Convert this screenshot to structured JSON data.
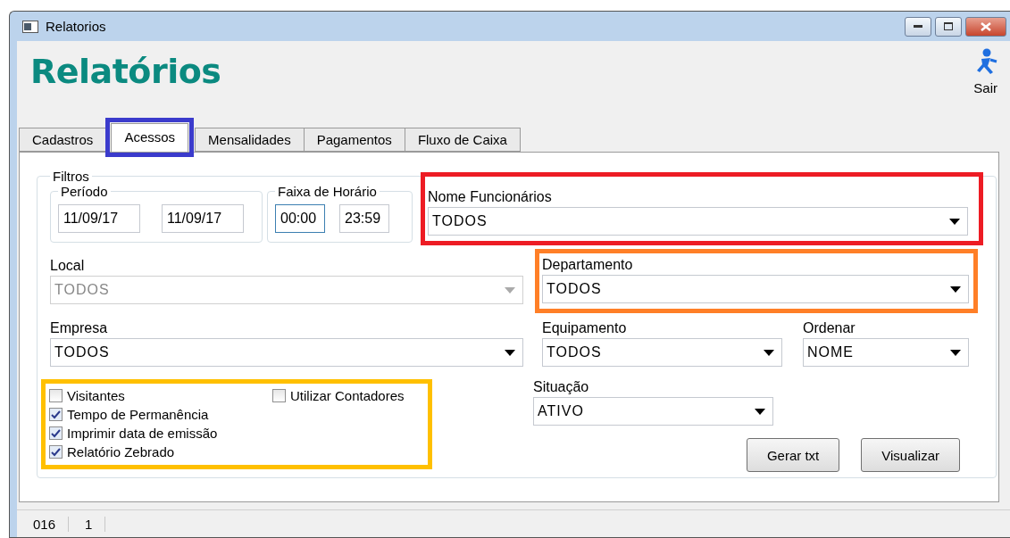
{
  "window": {
    "title": "Relatorios"
  },
  "header": {
    "title": "Relatórios",
    "exit_label": "Sair"
  },
  "tabs": {
    "color": "#3b3bcc",
    "items": [
      {
        "label": "Cadastros",
        "selected": false
      },
      {
        "label": "Acessos",
        "selected": true
      },
      {
        "label": "Mensalidades",
        "selected": false
      },
      {
        "label": "Pagamentos",
        "selected": false
      },
      {
        "label": "Fluxo de Caixa",
        "selected": false
      }
    ]
  },
  "filters": {
    "title": "Filtros",
    "periodo": {
      "label": "Período",
      "fields": [
        {
          "value": "11/09/17",
          "focused": false
        },
        {
          "value": "11/09/17",
          "focused": false
        }
      ]
    },
    "faixa_horario": {
      "label": "Faixa de Horário",
      "fields": [
        {
          "value": "00:00",
          "focused": true
        },
        {
          "value": "23:59",
          "focused": false
        }
      ]
    },
    "nome_funcionarios": {
      "label": "Nome Funcionários",
      "value": "TODOS",
      "color": "#ed1c24"
    },
    "local": {
      "label": "Local",
      "value": "TODOS",
      "disabled": true
    },
    "departamento": {
      "label": "Departamento",
      "value": "TODOS",
      "color": "#ff7f27"
    },
    "empresa": {
      "label": "Empresa",
      "value": "TODOS",
      "disabled": false
    },
    "equipamento": {
      "label": "Equipamento",
      "value": "TODOS"
    },
    "ordenar": {
      "label": "Ordenar",
      "value": "NOME"
    },
    "situacao": {
      "label": "Situação",
      "value": "ATIVO"
    },
    "options": {
      "color": "#ffc000",
      "items": [
        {
          "label": "Visitantes",
          "checked": false
        },
        {
          "label": "Utilizar Contadores",
          "checked": false
        },
        {
          "label": "Tempo de Permanência",
          "checked": true
        },
        {
          "label": "Imprimir data de emissão",
          "checked": true
        },
        {
          "label": "Relatório Zebrado",
          "checked": true
        }
      ]
    },
    "buttons": [
      "Gerar txt",
      "Visualizar"
    ]
  },
  "status_bar": [
    "016",
    "1"
  ]
}
